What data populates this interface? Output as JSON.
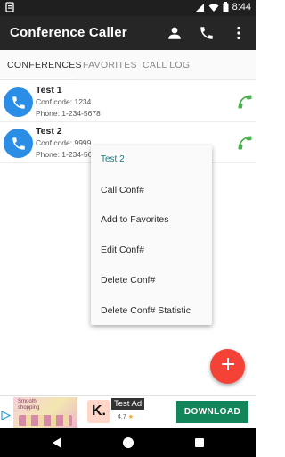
{
  "status_bar": {
    "time": "8:44"
  },
  "app": {
    "title": "Conference Caller"
  },
  "tabs": [
    {
      "label": "CONFERENCES",
      "active": true
    },
    {
      "label": "FAVORITES",
      "active": false
    },
    {
      "label": "CALL LOG",
      "active": false
    }
  ],
  "conferences": [
    {
      "title": "Test 1",
      "code": "Conf code: 1234",
      "phone": "Phone: 1-234-5678"
    },
    {
      "title": "Test 2",
      "code": "Conf code: 9999",
      "phone": "Phone: 1-234-5678"
    }
  ],
  "context_menu": {
    "header": "Test 2",
    "items": [
      "Call Conf#",
      "Add to Favorites",
      "Edit Conf#",
      "Delete Conf#",
      "Delete Conf# Statistic"
    ]
  },
  "ad": {
    "thumb_text_line1": "Smooth",
    "thumb_text_line2": "shopping",
    "logo_letter": "K.",
    "label": "Test Ad",
    "rating": "4.7",
    "star": "★",
    "button": "DOWNLOAD"
  },
  "colors": {
    "accent_blue": "#2a8de6",
    "call_green": "#4caf50",
    "fab_red": "#f44336",
    "menu_header_teal": "#1b7a80",
    "download_green": "#12865a"
  },
  "icons": [
    "signal-icon",
    "wifi-icon",
    "battery-icon",
    "person-icon",
    "phone-icon",
    "more-vert-icon",
    "phone-handset-icon",
    "plus-icon",
    "ad-choices-icon",
    "back-icon",
    "home-icon",
    "recents-icon"
  ]
}
